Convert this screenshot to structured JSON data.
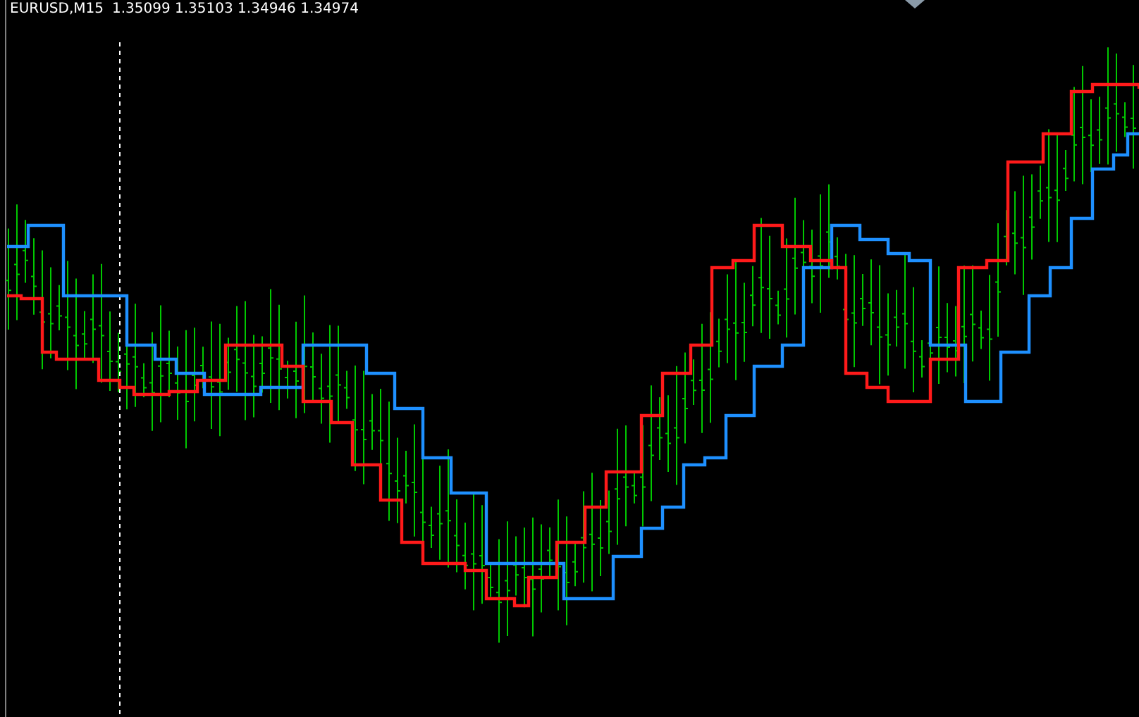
{
  "chart_header": {
    "symbol": "EURUSD,M15",
    "quotes": "1.35099 1.35103 1.34946 1.34974"
  }
}
